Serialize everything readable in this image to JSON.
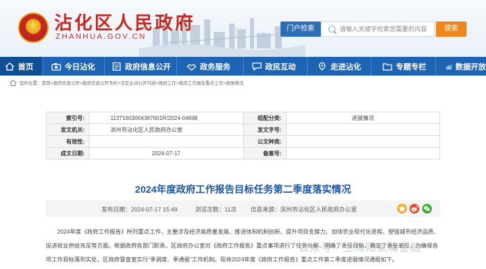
{
  "site": {
    "title": "沾化区人民政府",
    "domain": "ZHANHUA.GOV.CN",
    "portal_label": "门户检索",
    "search_placeholder": "请输入关键字检索您需要的内容",
    "search_button": "搜索"
  },
  "nav": [
    {
      "label": "首页",
      "icon": "home-icon"
    },
    {
      "label": "今日沾化",
      "icon": "camera-icon"
    },
    {
      "label": "政府信息公开",
      "icon": "document-icon"
    },
    {
      "label": "政务服务",
      "icon": "handshake-icon"
    },
    {
      "label": "政民互动",
      "icon": "chat-icon"
    },
    {
      "label": "走进沾化",
      "icon": "location-icon"
    },
    {
      "label": "专题专栏",
      "icon": "folder-icon"
    },
    {
      "label": "数据开放",
      "icon": "chart-icon"
    }
  ],
  "breadcrumb": "您的位置：首页>政府信息公开>政府信息公开专栏>法定主动公开内容>政府工作>政府工作报告重点工作>进展情况",
  "info": {
    "index_label": "索引号:",
    "index_value": "11371603004387601R/2024-04698",
    "category_label": "组配分类:",
    "category_value": "进展情况",
    "issuer_label": "发文机关:",
    "issuer_value": "滨州市沾化区人民政府办公室",
    "doc_no_label": "发文字号:",
    "doc_no_value": "",
    "validity_label": "有效性:",
    "validity_value": "",
    "format_label": "公文种类:",
    "format_value": "",
    "date_label": "成文日期:",
    "date_value": "2024-07-17",
    "record_label": "备案号:",
    "record_value": ""
  },
  "article": {
    "title": "2024年度政府工作报告目标任务第二季度落实情况",
    "published": "发布日期：2024-07-17 15:49",
    "views": "浏览次数：11次",
    "source": "信息来源：滨州市沾化区人民政府办公室",
    "paragraph": "2024年度《政府工作报告》所列重点工作，主要涉及经济高质量发展、推进体制机制创新、提升项目支撑力、加快农业现代化进程、塑强城市经济品质、促进就业供给充足等方面。根据政府各部门职责，区政府办公室对《政府工作报告》重点事项进行了任务分解，明确了责任目标，确定了责任单位，为确保各项工作目标落到实处，区政府督查室实行“季调度、季通报”工作机制。现将2024年度《政府工作报告》重点工作第二季度进展情况通报如下。"
  },
  "watermark": "公众号 · 上海陆家嘴金融",
  "colors": {
    "brand_red": "#c8281e",
    "nav_blue": "#1e64b4",
    "title_blue": "#1e56a0",
    "search_orange": "#f0861b"
  }
}
